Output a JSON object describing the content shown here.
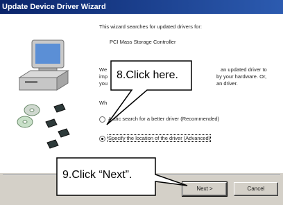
{
  "window": {
    "title": "Update Device Driver Wizard"
  },
  "wizard": {
    "intro": "This wizard searches for updated drivers for:",
    "device": "PCI Mass Storage Controller",
    "para_line1": "We",
    "para_line1_tail": "an updated driver to",
    "para_line2": "imp",
    "para_line2_tail": "by your hardware. Or,",
    "para_line3": "you",
    "para_line3_tail": "an driver.",
    "prompt": "Wh",
    "option1": "Automatic search for a better driver (Recommended)",
    "option1_visible": "A         atic search for a better driver (Recommended)",
    "option2": "Specify the location of the driver (Advanced)"
  },
  "buttons": {
    "next": "Next >",
    "cancel": "Cancel"
  },
  "callouts": {
    "step8": "8.Click here.",
    "step9": "9.Click “Next”."
  }
}
